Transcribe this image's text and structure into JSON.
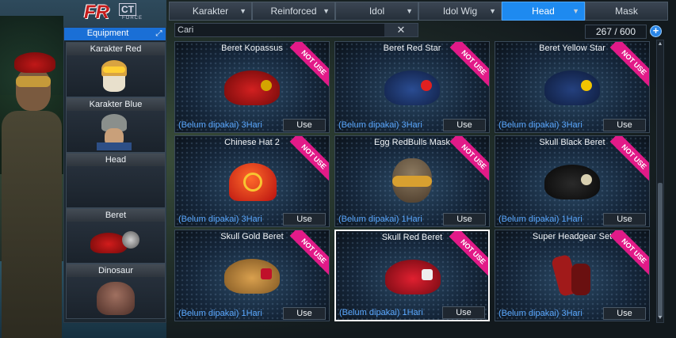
{
  "logo": {
    "text_fr": "FR",
    "text_ct": "CT",
    "text_force": "FORCE"
  },
  "equipment": {
    "title": "Equipment",
    "expand_icon": "expand-icon",
    "slots": [
      {
        "label": "Karakter Red"
      },
      {
        "label": "Karakter Blue"
      },
      {
        "label": "Head"
      },
      {
        "label": "Beret"
      },
      {
        "label": "Dinosaur"
      }
    ]
  },
  "tabs": [
    {
      "label": "Karakter",
      "dropdown": true,
      "active": false
    },
    {
      "label": "Reinforced",
      "dropdown": true,
      "active": false
    },
    {
      "label": "Idol",
      "dropdown": true,
      "active": false
    },
    {
      "label": "Idol Wig",
      "dropdown": true,
      "active": false
    },
    {
      "label": "Head",
      "dropdown": true,
      "active": true
    },
    {
      "label": "Mask",
      "dropdown": false,
      "active": false
    }
  ],
  "tab_arrow": "▼",
  "search": {
    "placeholder": "Cari",
    "clear_symbol": "✕"
  },
  "inventory_count": "267 / 600",
  "add_symbol": "+",
  "items": [
    {
      "name": "Beret Kopassus",
      "ribbon": "NOT USE",
      "status": "(Belum dipakai) 3Hari",
      "button": "Use",
      "kind": "beret",
      "color": "#c01515",
      "badge_color": "#d4a400"
    },
    {
      "name": "Beret Red Star",
      "ribbon": "NOT USE",
      "status": "(Belum dipakai) 3Hari",
      "button": "Use",
      "kind": "beret",
      "color": "#1d3a78",
      "badge_color": "#e02020"
    },
    {
      "name": "Beret Yellow Star",
      "ribbon": "NOT USE",
      "status": "(Belum dipakai) 3Hari",
      "button": "Use",
      "kind": "beret",
      "color": "#1a2f66",
      "badge_color": "#f2c400"
    },
    {
      "name": "Chinese Hat 2",
      "ribbon": "NOT USE",
      "status": "(Belum dipakai) 3Hari",
      "button": "Use",
      "kind": "hat",
      "color": "#d02010",
      "badge_color": "#f7c531"
    },
    {
      "name": "Egg RedBulls Mask",
      "ribbon": "NOT USE",
      "status": "(Belum dipakai) 1Hari",
      "button": "Use",
      "kind": "mask",
      "color": "#7a6650",
      "badge_color": "#d8a030"
    },
    {
      "name": "Skull Black Beret",
      "ribbon": "NOT USE",
      "status": "(Belum dipakai) 1Hari",
      "button": "Use",
      "kind": "beret",
      "color": "#141414",
      "badge_color": "#d8cfb0"
    },
    {
      "name": "Skull Gold Beret",
      "ribbon": "NOT USE",
      "status": "(Belum dipakai) 1Hari",
      "button": "Use",
      "kind": "beret",
      "color": "#c08a3a",
      "badge_color": "#c0102a"
    },
    {
      "name": "Skull Red Beret",
      "ribbon": "NOT USE",
      "status": "(Belum dipakai) 1Hari",
      "button": "Use",
      "kind": "beret",
      "color": "#c01020",
      "badge_color": "#eeeeee",
      "selected": true
    },
    {
      "name": "Super Headgear Set",
      "ribbon": "NOT USE",
      "status": "(Belum dipakai) 3Hari",
      "button": "Use",
      "kind": "gear",
      "color": "#a11a1a",
      "badge_color": "#6a1010"
    }
  ],
  "scrollbar": {
    "up_symbol": "▲",
    "down_symbol": "▼"
  },
  "colors": {
    "accent": "#1e8af0",
    "ribbon": "#e21a88",
    "status_text": "#5aa8ff"
  }
}
